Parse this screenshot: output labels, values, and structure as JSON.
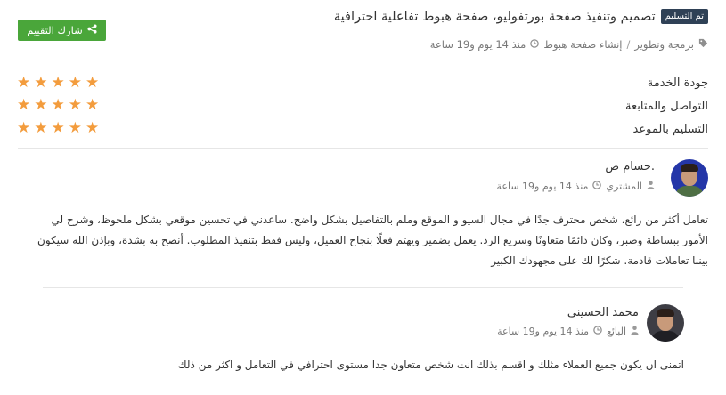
{
  "header": {
    "badge": "تم التسليم",
    "title": "تصميم وتنفيذ صفحة بورتفوليو، صفحة هبوط تفاعلية احترافية",
    "share_label": "شارك التقييم",
    "category": "برمجة وتطوير",
    "subcategory": "إنشاء صفحة هبوط",
    "time": "منذ 14 يوم و19 ساعة"
  },
  "ratings": [
    {
      "label": "جودة الخدمة",
      "stars": 5
    },
    {
      "label": "التواصل والمتابعة",
      "stars": 5
    },
    {
      "label": "التسليم بالموعد",
      "stars": 5
    }
  ],
  "comments": [
    {
      "name": "حسام ص.",
      "role": "المشتري",
      "time": "منذ 14 يوم و19 ساعة",
      "lines": [
        "تعامل أكثر من رائع، شخص محترف جدًا في مجال السيو و الموقع وملم بالتفاصيل بشكل واضح. ساعدني في تحسين موقعي بشكل ملحوظ، وشرح لي",
        "الأمور ببساطة وصبر، وكان دائمًا متعاونًا وسريع الرد. يعمل بضمير ويهتم فعلًا بنجاح العميل، وليس فقط بتنفيذ المطلوب. أنصح به بشدة، وبإذن الله سيكون",
        "بيننا تعاملات قادمة. شكرًا لك على مجهودك الكبير"
      ]
    },
    {
      "name": "محمد الحسيني",
      "role": "البائع",
      "time": "منذ 14 يوم و19 ساعة",
      "lines": [
        "اتمنى ان يكون جميع العملاء مثلك و اقسم بذلك انت شخص متعاون جدا مستوى احترافي في التعامل و اكثر من ذلك"
      ]
    }
  ],
  "icons": {
    "share": "share-icon",
    "tag": "tag-icon",
    "clock": "clock-icon",
    "user": "user-icon",
    "star": "star-icon"
  },
  "colors": {
    "badge_bg": "#2f4156",
    "share_button": "#4aa63a",
    "star": "#f39c3d"
  }
}
